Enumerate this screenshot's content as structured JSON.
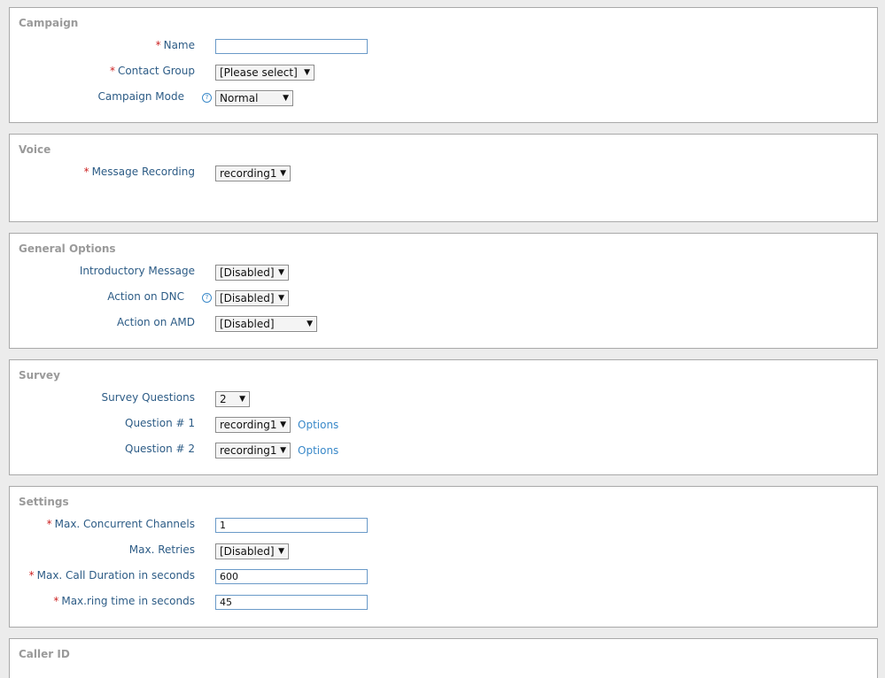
{
  "campaign": {
    "title": "Campaign",
    "name_label": "Name",
    "name_value": "",
    "contact_group_label": "Contact Group",
    "contact_group_value": "[Please select]",
    "mode_label": "Campaign Mode",
    "mode_value": "Normal",
    "help_glyph": "?"
  },
  "voice": {
    "title": "Voice",
    "message_label": "Message Recording",
    "message_value": "recording1"
  },
  "general": {
    "title": "General Options",
    "intro_label": "Introductory Message",
    "intro_value": "[Disabled]",
    "dnc_label": "Action on DNC",
    "dnc_value": "[Disabled]",
    "amd_label": "Action on AMD",
    "amd_value": "[Disabled]",
    "help_glyph": "?"
  },
  "survey": {
    "title": "Survey",
    "questions_label": "Survey Questions",
    "questions_value": "2",
    "q1_label": "Question # 1",
    "q1_value": "recording1",
    "q2_label": "Question # 2",
    "q2_value": "recording1",
    "options_label": "Options"
  },
  "settings": {
    "title": "Settings",
    "channels_label": "Max. Concurrent Channels",
    "channels_value": "1",
    "retries_label": "Max. Retries",
    "retries_value": "[Disabled]",
    "duration_label": "Max. Call Duration in seconds",
    "duration_value": "600",
    "ring_label": "Max.ring time in seconds",
    "ring_value": "45"
  },
  "caller_id": {
    "title": "Caller ID"
  },
  "required_marker": "*",
  "select_arrow": "▼"
}
